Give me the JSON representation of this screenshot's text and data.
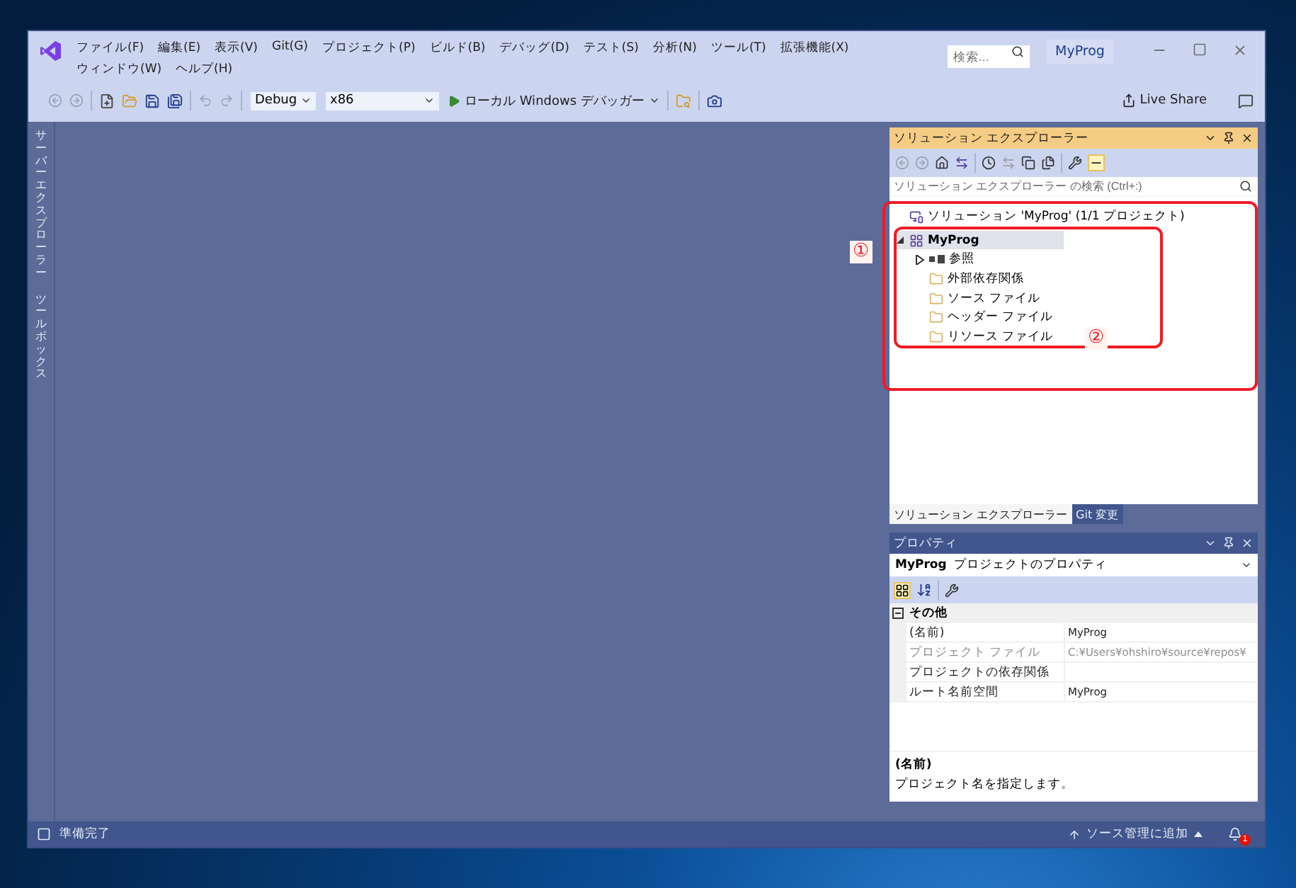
{
  "window": {
    "menu": [
      "ファイル(F)",
      "編集(E)",
      "表示(V)",
      "Git(G)",
      "プロジェクト(P)",
      "ビルド(B)",
      "デバッグ(D)",
      "テスト(S)",
      "分析(N)",
      "ツール(T)",
      "拡張機能(X)",
      "ウィンドウ(W)",
      "ヘルプ(H)"
    ],
    "search": {
      "placeholder": "検索..."
    },
    "title": "MyProg"
  },
  "toolbar": {
    "configuration": "Debug",
    "platform": "x86",
    "run": "ローカル Windows デバッガー",
    "live_share": "Live Share"
  },
  "side_tabs": [
    "サーバーエクスプローラー",
    "ツールボックス"
  ],
  "solution_explorer": {
    "title": "ソリューション エクスプローラー",
    "search": {
      "placeholder": "ソリューション エクスプローラー の検索 (Ctrl+:)"
    },
    "tree": [
      {
        "label": "ソリューション 'MyProg' (1/1 プロジェクト)",
        "kind": "solution",
        "selected": false,
        "children": [
          {
            "label": "MyProg",
            "kind": "project",
            "expanded": true,
            "selected": true,
            "children": [
              {
                "label": "参照",
                "kind": "references",
                "expanded": false,
                "selected": false
              },
              {
                "label": "外部依存関係",
                "kind": "external",
                "selected": false
              },
              {
                "label": "ソース ファイル",
                "kind": "filter",
                "selected": false
              },
              {
                "label": "ヘッダー ファイル",
                "kind": "filter",
                "selected": false
              },
              {
                "label": "リソース ファイル",
                "kind": "filter",
                "selected": false
              }
            ]
          }
        ]
      }
    ],
    "tabs": [
      {
        "label": "ソリューション エクスプローラー",
        "selected": true
      },
      {
        "label": "Git 変更",
        "selected": false
      }
    ]
  },
  "annotations": [
    "①",
    "②"
  ],
  "properties": {
    "title": "プロパティ",
    "object": "MyProg",
    "object_type": "プロジェクトのプロパティ",
    "category": "その他",
    "category_expanded": true,
    "rows": [
      {
        "name": "(名前)",
        "value": "MyProg",
        "disabled": false
      },
      {
        "name": "プロジェクト ファイル",
        "value": "C:¥Users¥ohshiro¥source¥repos¥",
        "disabled": true
      },
      {
        "name": "プロジェクトの依存関係",
        "disabled": false
      },
      {
        "name": "ルート名前空間",
        "value": "MyProg",
        "disabled": false
      }
    ],
    "description_title": "(名前)",
    "description": "プロジェクト名を指定します。"
  },
  "status_bar": {
    "status": "準備完了",
    "source_control": "ソース管理に追加",
    "notifications": "1"
  }
}
